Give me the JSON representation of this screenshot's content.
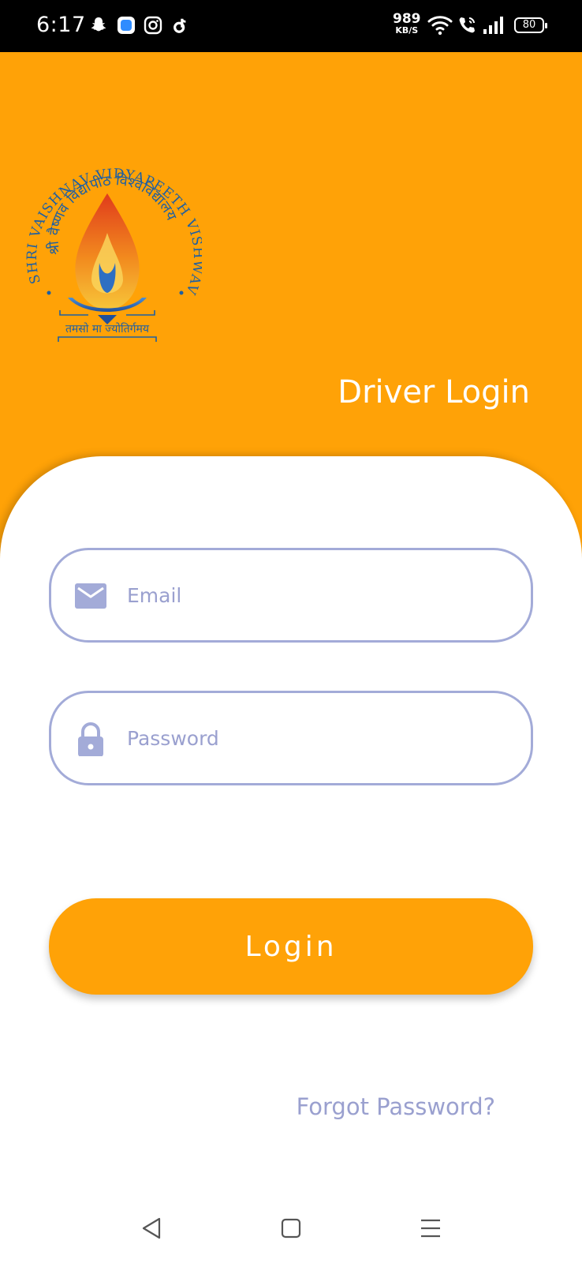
{
  "status_bar": {
    "time": "6:17",
    "net_speed_value": "989",
    "net_speed_unit": "KB/S",
    "battery": "80",
    "icons": [
      "snapchat-icon",
      "app-icon",
      "instagram-icon",
      "tiktok-icon",
      "wifi-icon",
      "wifi-calling-icon",
      "signal-icon",
      "battery-icon"
    ]
  },
  "header": {
    "logo": {
      "name": "SHRI VAISHNAV VIDYAPEETH VISHWAVIDYALAYA",
      "motto": "तमसो मा ज्योतिर्गमय",
      "hindi_name": "श्री वैष्णव विद्यापीठ विश्वविद्यालय"
    },
    "title": "Driver Login"
  },
  "form": {
    "email_placeholder": "Email",
    "password_placeholder": "Password",
    "login_label": "Login",
    "forgot_label": "Forgot Password?"
  },
  "colors": {
    "primary": "#ffa207",
    "field_border": "#a3abd8",
    "placeholder": "#9aa0cf"
  }
}
